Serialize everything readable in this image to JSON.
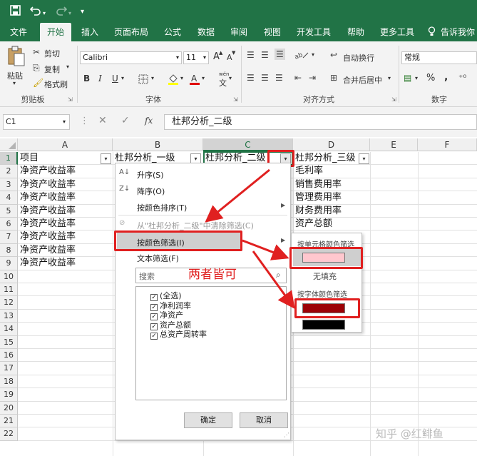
{
  "qat": {
    "save_icon": "save-icon",
    "undo_icon": "undo-icon",
    "redo_icon": "redo-icon",
    "more_icon": "customize-icon"
  },
  "tabs": [
    "文件",
    "开始",
    "插入",
    "页面布局",
    "公式",
    "数据",
    "审阅",
    "视图",
    "开发工具",
    "帮助",
    "更多工具",
    "告诉我你"
  ],
  "active_tab": "开始",
  "ribbon": {
    "clipboard": {
      "paste": "粘贴",
      "cut": "剪切",
      "copy": "复制",
      "format_painter": "格式刷",
      "label": "剪贴板"
    },
    "font": {
      "name": "Calibri",
      "size": "11",
      "grow": "A",
      "shrink": "A",
      "label": "字体",
      "bold": "B",
      "italic": "I",
      "underline": "U",
      "wen": "wén",
      "wen2": "文"
    },
    "alignment": {
      "wrap": "自动换行",
      "merge": "合并后居中",
      "label": "对齐方式",
      "ab": "ab"
    },
    "number": {
      "format": "常规",
      "percent": "%",
      "comma": ",",
      "label": "数字"
    }
  },
  "formula_bar": {
    "name_box": "C1",
    "fx": "fx",
    "value": "杜邦分析_二级"
  },
  "columns": [
    "A",
    "B",
    "C",
    "D",
    "E",
    "F"
  ],
  "rows": [
    "1",
    "2",
    "3",
    "4",
    "5",
    "6",
    "7",
    "8",
    "9",
    "10",
    "11",
    "12",
    "13",
    "14",
    "15",
    "16",
    "17",
    "18",
    "19",
    "20",
    "21",
    "22"
  ],
  "headers": {
    "a1": "项目",
    "b1": "杜邦分析_一级",
    "c1": "杜邦分析_二级",
    "d1": "杜邦分析_三级"
  },
  "col_a": [
    "净资产收益率",
    "净资产收益率",
    "净资产收益率",
    "净资产收益率",
    "净资产收益率",
    "净资产收益率",
    "净资产收益率",
    "净资产收益率"
  ],
  "col_d": [
    "毛利率",
    "销售费用率",
    "管理费用率",
    "财务费用率",
    "资产总额"
  ],
  "menu": {
    "sort_asc": "升序(S)",
    "sort_desc": "降序(O)",
    "sort_color": "按颜色排序(T)",
    "clear": "从\"杜邦分析_二级\"中清除筛选(C)",
    "filter_color": "按颜色筛选(I)",
    "text_filter": "文本筛选(F)",
    "search_placeholder": "搜索",
    "items": [
      "(全选)",
      "净利润率",
      "净资产",
      "资产总额",
      "总资产周转率"
    ],
    "ok": "确定",
    "cancel": "取消"
  },
  "submenu": {
    "cell_color_title": "按单元格颜色筛选",
    "no_fill": "无填充",
    "font_color_title": "按字体颜色筛选",
    "cell_color": "#ffc7ce",
    "font_colors": [
      "#9c0006",
      "#000000"
    ]
  },
  "annotation": "两者皆可",
  "watermark": "知乎 @红鲱鱼",
  "colors": {
    "excel_green": "#217346",
    "annotation_red": "#e02020"
  }
}
